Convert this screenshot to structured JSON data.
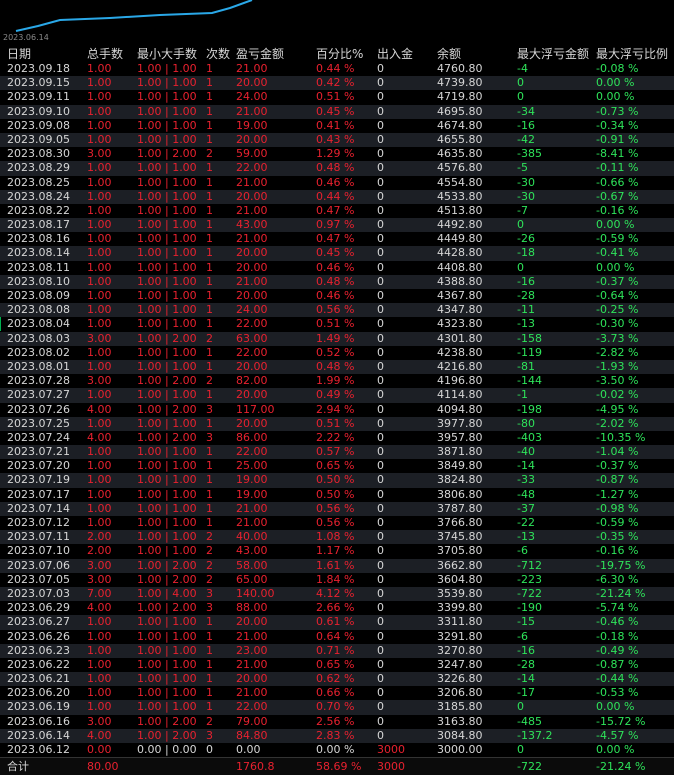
{
  "chart": {
    "axis_date": "2023.06.14",
    "line_color": "#2aa8e8"
  },
  "colors": {
    "profit": "#e8212f",
    "loss": "#2ee35a",
    "text": "#d6d6d6",
    "bg": "#000000",
    "row_alt": "#1c1f25"
  },
  "headers": [
    "日期",
    "总手数",
    "最小大手数",
    "次数",
    "盈亏金额",
    "百分比%",
    "出入金",
    "余额",
    "最大浮亏金额",
    "最大浮亏比例"
  ],
  "rows": [
    [
      "2023.09.18",
      "1.00",
      "1.00 | 1.00",
      "1",
      "21.00",
      "0.44 %",
      "0",
      "4760.80",
      "-4",
      "-0.08 %"
    ],
    [
      "2023.09.15",
      "1.00",
      "1.00 | 1.00",
      "1",
      "20.00",
      "0.42 %",
      "0",
      "4739.80",
      "0",
      "0.00 %"
    ],
    [
      "2023.09.11",
      "1.00",
      "1.00 | 1.00",
      "1",
      "24.00",
      "0.51 %",
      "0",
      "4719.80",
      "0",
      "0.00 %"
    ],
    [
      "2023.09.10",
      "1.00",
      "1.00 | 1.00",
      "1",
      "21.00",
      "0.45 %",
      "0",
      "4695.80",
      "-34",
      "-0.73 %"
    ],
    [
      "2023.09.08",
      "1.00",
      "1.00 | 1.00",
      "1",
      "19.00",
      "0.41 %",
      "0",
      "4674.80",
      "-16",
      "-0.34 %"
    ],
    [
      "2023.09.05",
      "1.00",
      "1.00 | 1.00",
      "1",
      "20.00",
      "0.43 %",
      "0",
      "4655.80",
      "-42",
      "-0.91 %"
    ],
    [
      "2023.08.30",
      "3.00",
      "1.00 | 2.00",
      "2",
      "59.00",
      "1.29 %",
      "0",
      "4635.80",
      "-385",
      "-8.41 %"
    ],
    [
      "2023.08.29",
      "1.00",
      "1.00 | 1.00",
      "1",
      "22.00",
      "0.48 %",
      "0",
      "4576.80",
      "-5",
      "-0.11 %"
    ],
    [
      "2023.08.25",
      "1.00",
      "1.00 | 1.00",
      "1",
      "21.00",
      "0.46 %",
      "0",
      "4554.80",
      "-30",
      "-0.66 %"
    ],
    [
      "2023.08.24",
      "1.00",
      "1.00 | 1.00",
      "1",
      "20.00",
      "0.44 %",
      "0",
      "4533.80",
      "-30",
      "-0.67 %"
    ],
    [
      "2023.08.22",
      "1.00",
      "1.00 | 1.00",
      "1",
      "21.00",
      "0.47 %",
      "0",
      "4513.80",
      "-7",
      "-0.16 %"
    ],
    [
      "2023.08.17",
      "1.00",
      "1.00 | 1.00",
      "1",
      "43.00",
      "0.97 %",
      "0",
      "4492.80",
      "0",
      "0.00 %"
    ],
    [
      "2023.08.16",
      "1.00",
      "1.00 | 1.00",
      "1",
      "21.00",
      "0.47 %",
      "0",
      "4449.80",
      "-26",
      "-0.59 %"
    ],
    [
      "2023.08.14",
      "1.00",
      "1.00 | 1.00",
      "1",
      "20.00",
      "0.45 %",
      "0",
      "4428.80",
      "-18",
      "-0.41 %"
    ],
    [
      "2023.08.11",
      "1.00",
      "1.00 | 1.00",
      "1",
      "20.00",
      "0.46 %",
      "0",
      "4408.80",
      "0",
      "0.00 %"
    ],
    [
      "2023.08.10",
      "1.00",
      "1.00 | 1.00",
      "1",
      "21.00",
      "0.48 %",
      "0",
      "4388.80",
      "-16",
      "-0.37 %"
    ],
    [
      "2023.08.09",
      "1.00",
      "1.00 | 1.00",
      "1",
      "20.00",
      "0.46 %",
      "0",
      "4367.80",
      "-28",
      "-0.64 %"
    ],
    [
      "2023.08.08",
      "1.00",
      "1.00 | 1.00",
      "1",
      "24.00",
      "0.56 %",
      "0",
      "4347.80",
      "-11",
      "-0.25 %"
    ],
    [
      "2023.08.04",
      "1.00",
      "1.00 | 1.00",
      "1",
      "22.00",
      "0.51 %",
      "0",
      "4323.80",
      "-13",
      "-0.30 %"
    ],
    [
      "2023.08.03",
      "3.00",
      "1.00 | 2.00",
      "2",
      "63.00",
      "1.49 %",
      "0",
      "4301.80",
      "-158",
      "-3.73 %"
    ],
    [
      "2023.08.02",
      "1.00",
      "1.00 | 1.00",
      "1",
      "22.00",
      "0.52 %",
      "0",
      "4238.80",
      "-119",
      "-2.82 %"
    ],
    [
      "2023.08.01",
      "1.00",
      "1.00 | 1.00",
      "1",
      "20.00",
      "0.48 %",
      "0",
      "4216.80",
      "-81",
      "-1.93 %"
    ],
    [
      "2023.07.28",
      "3.00",
      "1.00 | 2.00",
      "2",
      "82.00",
      "1.99 %",
      "0",
      "4196.80",
      "-144",
      "-3.50 %"
    ],
    [
      "2023.07.27",
      "1.00",
      "1.00 | 1.00",
      "1",
      "20.00",
      "0.49 %",
      "0",
      "4114.80",
      "-1",
      "-0.02 %"
    ],
    [
      "2023.07.26",
      "4.00",
      "1.00 | 2.00",
      "3",
      "117.00",
      "2.94 %",
      "0",
      "4094.80",
      "-198",
      "-4.95 %"
    ],
    [
      "2023.07.25",
      "1.00",
      "1.00 | 1.00",
      "1",
      "20.00",
      "0.51 %",
      "0",
      "3977.80",
      "-80",
      "-2.02 %"
    ],
    [
      "2023.07.24",
      "4.00",
      "1.00 | 2.00",
      "3",
      "86.00",
      "2.22 %",
      "0",
      "3957.80",
      "-403",
      "-10.35 %"
    ],
    [
      "2023.07.21",
      "1.00",
      "1.00 | 1.00",
      "1",
      "22.00",
      "0.57 %",
      "0",
      "3871.80",
      "-40",
      "-1.04 %"
    ],
    [
      "2023.07.20",
      "1.00",
      "1.00 | 1.00",
      "1",
      "25.00",
      "0.65 %",
      "0",
      "3849.80",
      "-14",
      "-0.37 %"
    ],
    [
      "2023.07.19",
      "1.00",
      "1.00 | 1.00",
      "1",
      "19.00",
      "0.50 %",
      "0",
      "3824.80",
      "-33",
      "-0.87 %"
    ],
    [
      "2023.07.17",
      "1.00",
      "1.00 | 1.00",
      "1",
      "19.00",
      "0.50 %",
      "0",
      "3806.80",
      "-48",
      "-1.27 %"
    ],
    [
      "2023.07.14",
      "1.00",
      "1.00 | 1.00",
      "1",
      "21.00",
      "0.56 %",
      "0",
      "3787.80",
      "-37",
      "-0.98 %"
    ],
    [
      "2023.07.12",
      "1.00",
      "1.00 | 1.00",
      "1",
      "21.00",
      "0.56 %",
      "0",
      "3766.80",
      "-22",
      "-0.59 %"
    ],
    [
      "2023.07.11",
      "2.00",
      "1.00 | 1.00",
      "2",
      "40.00",
      "1.08 %",
      "0",
      "3745.80",
      "-13",
      "-0.35 %"
    ],
    [
      "2023.07.10",
      "2.00",
      "1.00 | 1.00",
      "2",
      "43.00",
      "1.17 %",
      "0",
      "3705.80",
      "-6",
      "-0.16 %"
    ],
    [
      "2023.07.06",
      "3.00",
      "1.00 | 2.00",
      "2",
      "58.00",
      "1.61 %",
      "0",
      "3662.80",
      "-712",
      "-19.75 %"
    ],
    [
      "2023.07.05",
      "3.00",
      "1.00 | 2.00",
      "2",
      "65.00",
      "1.84 %",
      "0",
      "3604.80",
      "-223",
      "-6.30 %"
    ],
    [
      "2023.07.03",
      "7.00",
      "1.00 | 4.00",
      "3",
      "140.00",
      "4.12 %",
      "0",
      "3539.80",
      "-722",
      "-21.24 %"
    ],
    [
      "2023.06.29",
      "4.00",
      "1.00 | 2.00",
      "3",
      "88.00",
      "2.66 %",
      "0",
      "3399.80",
      "-190",
      "-5.74 %"
    ],
    [
      "2023.06.27",
      "1.00",
      "1.00 | 1.00",
      "1",
      "20.00",
      "0.61 %",
      "0",
      "3311.80",
      "-15",
      "-0.46 %"
    ],
    [
      "2023.06.26",
      "1.00",
      "1.00 | 1.00",
      "1",
      "21.00",
      "0.64 %",
      "0",
      "3291.80",
      "-6",
      "-0.18 %"
    ],
    [
      "2023.06.23",
      "1.00",
      "1.00 | 1.00",
      "1",
      "23.00",
      "0.71 %",
      "0",
      "3270.80",
      "-16",
      "-0.49 %"
    ],
    [
      "2023.06.22",
      "1.00",
      "1.00 | 1.00",
      "1",
      "21.00",
      "0.65 %",
      "0",
      "3247.80",
      "-28",
      "-0.87 %"
    ],
    [
      "2023.06.21",
      "1.00",
      "1.00 | 1.00",
      "1",
      "20.00",
      "0.62 %",
      "0",
      "3226.80",
      "-14",
      "-0.44 %"
    ],
    [
      "2023.06.20",
      "1.00",
      "1.00 | 1.00",
      "1",
      "21.00",
      "0.66 %",
      "0",
      "3206.80",
      "-17",
      "-0.53 %"
    ],
    [
      "2023.06.19",
      "1.00",
      "1.00 | 1.00",
      "1",
      "22.00",
      "0.70 %",
      "0",
      "3185.80",
      "0",
      "0.00 %"
    ],
    [
      "2023.06.16",
      "3.00",
      "1.00 | 2.00",
      "2",
      "79.00",
      "2.56 %",
      "0",
      "3163.80",
      "-485",
      "-15.72 %"
    ],
    [
      "2023.06.14",
      "4.00",
      "1.00 | 2.00",
      "3",
      "84.80",
      "2.83 %",
      "0",
      "3084.80",
      "-137.2",
      "-4.57 %"
    ],
    [
      "2023.06.12",
      "0.00",
      "0.00 | 0.00",
      "0",
      "0.00",
      "0.00 %",
      "3000",
      "3000.00",
      "0",
      "0.00 %"
    ]
  ],
  "total": [
    "合计",
    "80.00",
    "",
    "",
    "1760.8",
    "58.69 %",
    "3000",
    "",
    "-722",
    "-21.24 %"
  ]
}
